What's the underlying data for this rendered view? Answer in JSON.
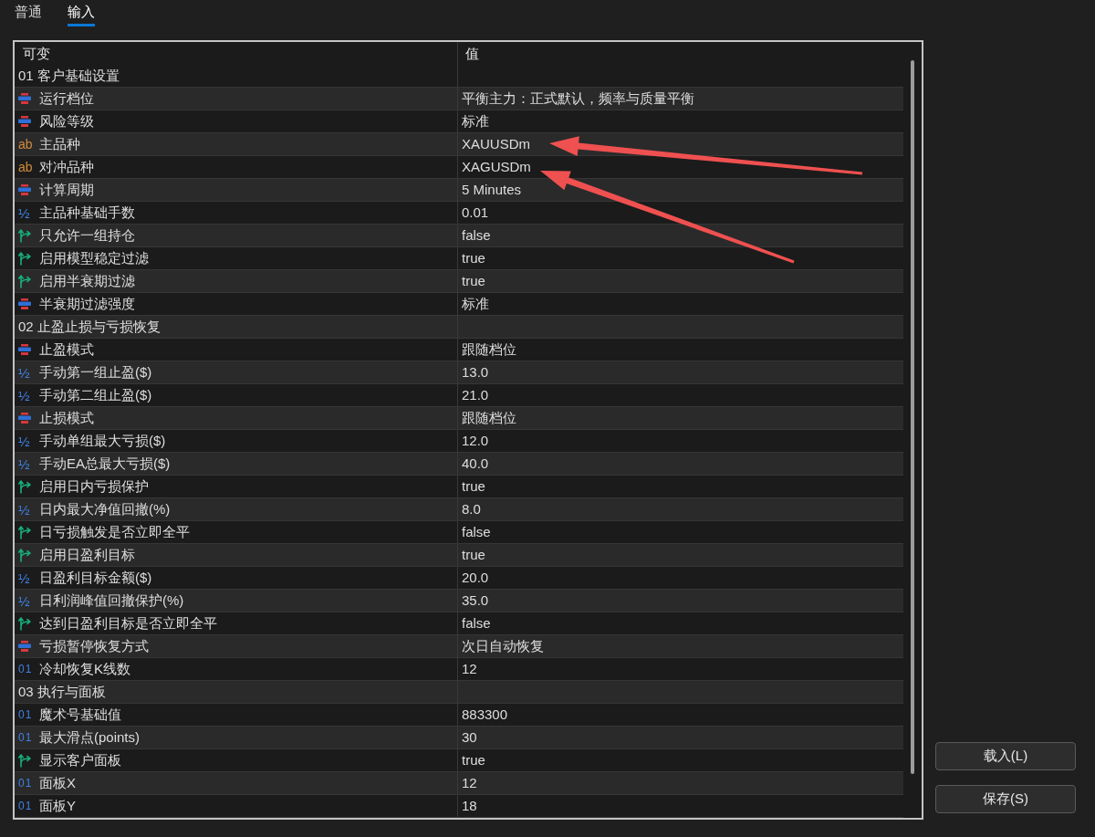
{
  "tabs": [
    {
      "label": "普通",
      "selected": false
    },
    {
      "label": "输入",
      "selected": true
    }
  ],
  "table": {
    "columns": [
      "可变",
      "值"
    ],
    "groups": [
      {
        "title": "01 客户基础设置",
        "rows": [
          {
            "kind": "enum",
            "name": "运行档位",
            "value": "平衡主力：正式默认，频率与质量平衡"
          },
          {
            "kind": "enum",
            "name": "风险等级",
            "value": "标准"
          },
          {
            "kind": "string",
            "glyph": "ab",
            "name": "主品种",
            "value": "XAUUSDm"
          },
          {
            "kind": "string",
            "glyph": "ab",
            "name": "对冲品种",
            "value": "XAGUSDm"
          },
          {
            "kind": "enum",
            "name": "计算周期",
            "value": "5 Minutes"
          },
          {
            "kind": "double",
            "glyph": "½",
            "name": "主品种基础手数",
            "value": "0.01"
          },
          {
            "kind": "bool",
            "name": "只允许一组持仓",
            "value": "false"
          },
          {
            "kind": "bool",
            "name": "启用模型稳定过滤",
            "value": "true"
          },
          {
            "kind": "bool",
            "name": "启用半衰期过滤",
            "value": "true"
          },
          {
            "kind": "enum",
            "name": "半衰期过滤强度",
            "value": "标准"
          }
        ]
      },
      {
        "title": "02 止盈止损与亏损恢复",
        "rows": [
          {
            "kind": "enum",
            "name": "止盈模式",
            "value": "跟随档位"
          },
          {
            "kind": "double",
            "glyph": "½",
            "name": "手动第一组止盈($)",
            "value": "13.0"
          },
          {
            "kind": "double",
            "glyph": "½",
            "name": "手动第二组止盈($)",
            "value": "21.0"
          },
          {
            "kind": "enum",
            "name": "止损模式",
            "value": "跟随档位"
          },
          {
            "kind": "double",
            "glyph": "½",
            "name": "手动单组最大亏损($)",
            "value": "12.0"
          },
          {
            "kind": "double",
            "glyph": "½",
            "name": "手动EA总最大亏损($)",
            "value": "40.0"
          },
          {
            "kind": "bool",
            "name": "启用日内亏损保护",
            "value": "true"
          },
          {
            "kind": "double",
            "glyph": "½",
            "name": "日内最大净值回撤(%)",
            "value": "8.0"
          },
          {
            "kind": "bool",
            "name": "日亏损触发是否立即全平",
            "value": "false"
          },
          {
            "kind": "bool",
            "name": "启用日盈利目标",
            "value": "true"
          },
          {
            "kind": "double",
            "glyph": "½",
            "name": "日盈利目标金额($)",
            "value": "20.0"
          },
          {
            "kind": "double",
            "glyph": "½",
            "name": "日利润峰值回撤保护(%)",
            "value": "35.0"
          },
          {
            "kind": "bool",
            "name": "达到日盈利目标是否立即全平",
            "value": "false"
          },
          {
            "kind": "enum",
            "name": "亏损暂停恢复方式",
            "value": "次日自动恢复"
          },
          {
            "kind": "int",
            "glyph": "01",
            "name": "冷却恢复K线数",
            "value": "12"
          }
        ]
      },
      {
        "title": "03 执行与面板",
        "rows": [
          {
            "kind": "int",
            "glyph": "01",
            "name": "魔术号基础值",
            "value": "883300"
          },
          {
            "kind": "int",
            "glyph": "01",
            "name": "最大滑点(points)",
            "value": "30"
          },
          {
            "kind": "bool",
            "name": "显示客户面板",
            "value": "true"
          },
          {
            "kind": "int",
            "glyph": "01",
            "name": "面板X",
            "value": "12"
          },
          {
            "kind": "int",
            "glyph": "01",
            "name": "面板Y",
            "value": "18"
          }
        ]
      }
    ]
  },
  "buttons": [
    "载入(L)",
    "保存(S)"
  ]
}
